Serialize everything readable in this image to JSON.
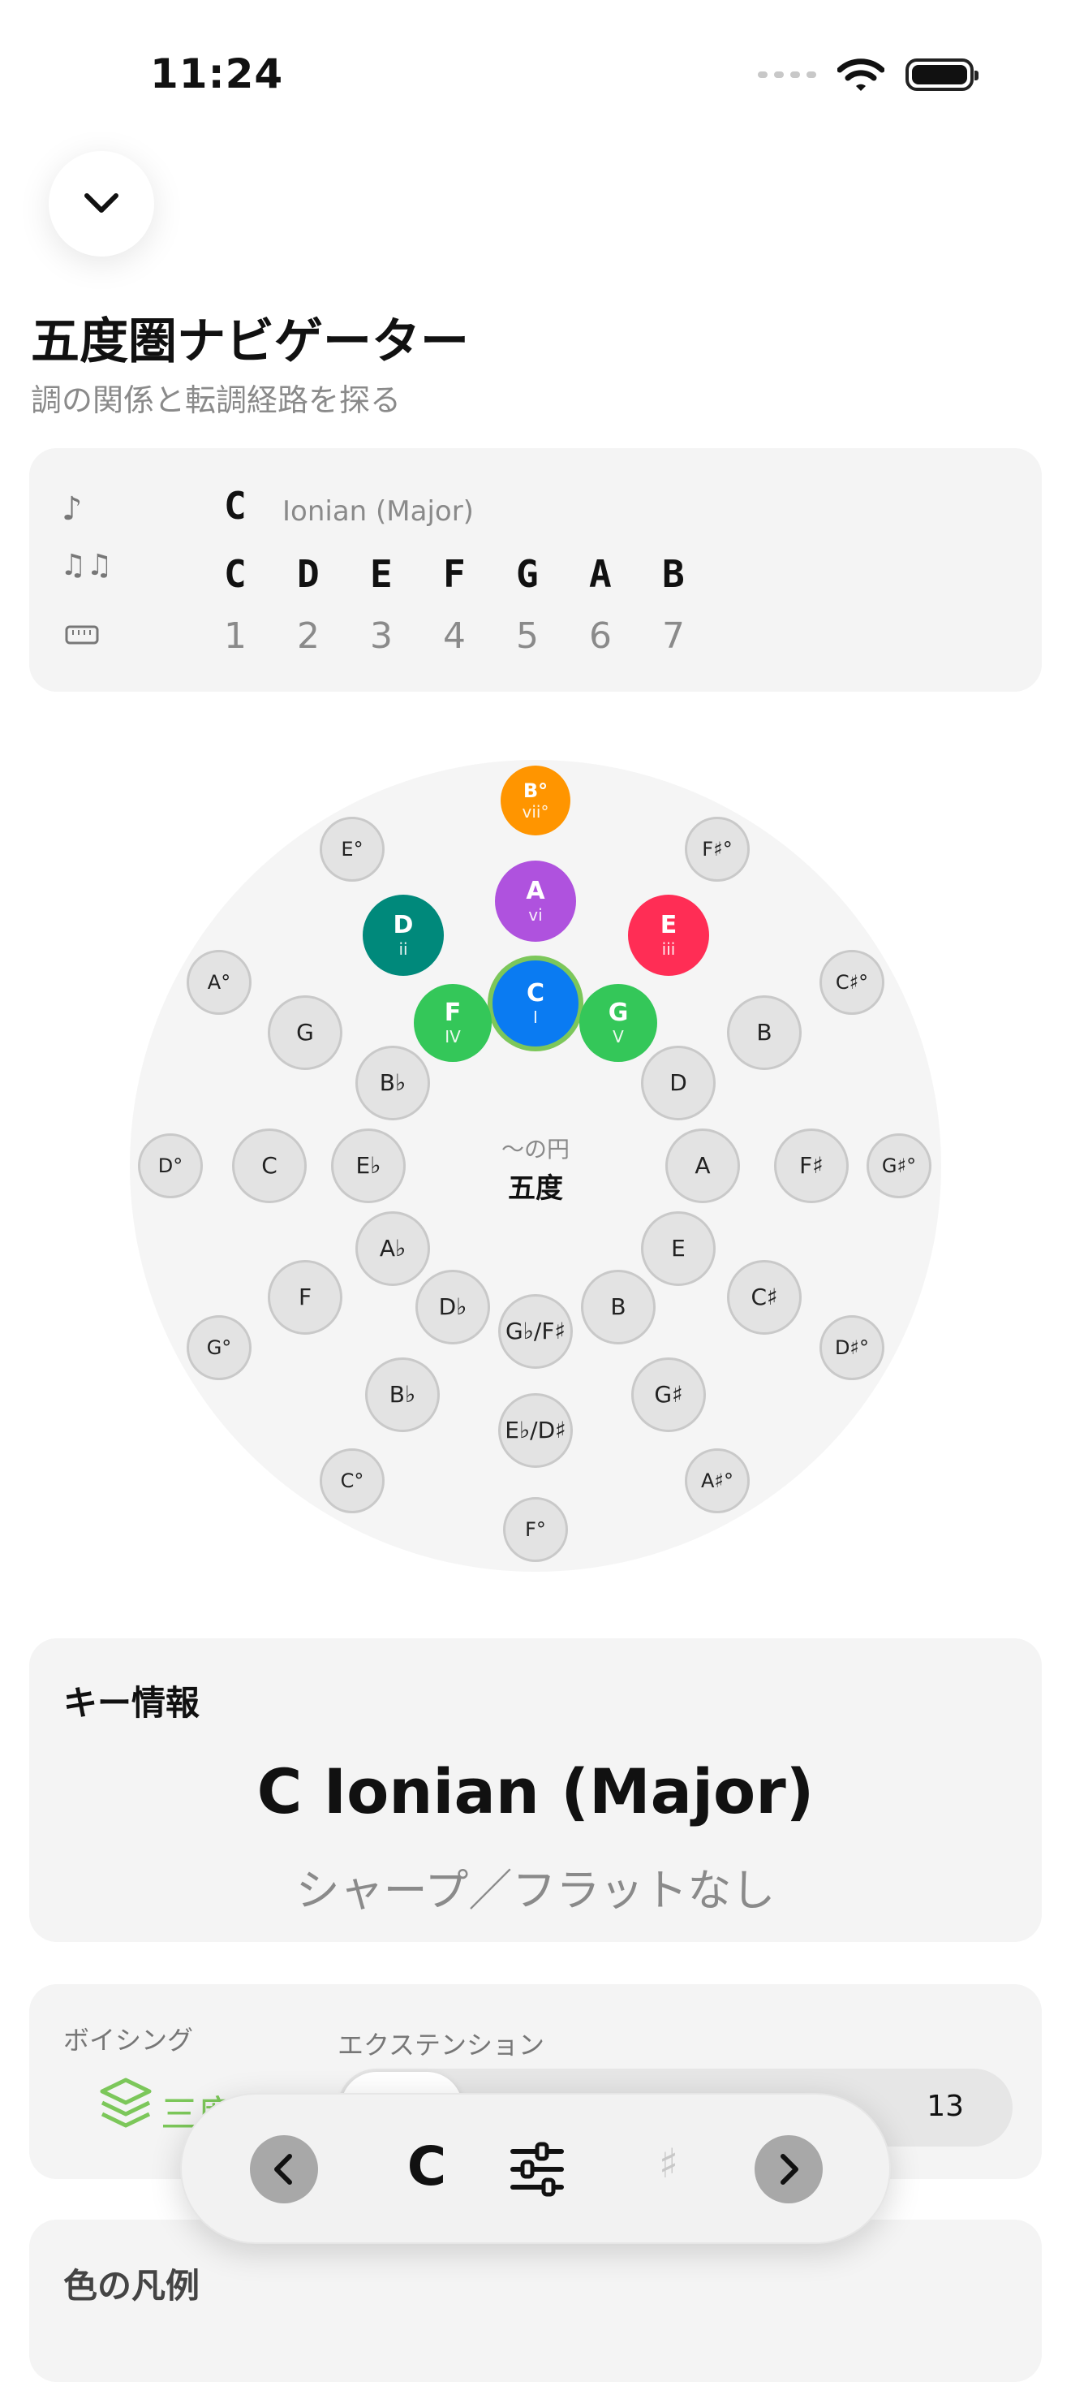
{
  "status": {
    "time": "11:24"
  },
  "header": {
    "title": "五度圏ナビゲーター",
    "subtitle": "調の関係と転調経路を探る"
  },
  "scale": {
    "root": "C",
    "mode": "Ionian (Major)",
    "notes": [
      "C",
      "D",
      "E",
      "F",
      "G",
      "A",
      "B"
    ],
    "degrees": [
      "1",
      "2",
      "3",
      "4",
      "5",
      "6",
      "7"
    ]
  },
  "circle": {
    "center_sub": "〜の円",
    "center_main": "五度",
    "diatonic": [
      {
        "name": "C",
        "roman": "I",
        "color": "#0a7bf2"
      },
      {
        "name": "G",
        "roman": "V",
        "color": "#34c759"
      },
      {
        "name": "F",
        "roman": "IV",
        "color": "#34c759"
      },
      {
        "name": "A",
        "roman": "vi",
        "color": "#af52de"
      },
      {
        "name": "E",
        "roman": "iii",
        "color": "#ff2d55"
      },
      {
        "name": "D",
        "roman": "ii",
        "color": "#00897b"
      },
      {
        "name": "B°",
        "roman": "vii°",
        "color": "#ff9500"
      }
    ],
    "major_ring": [
      "G",
      "D",
      "A",
      "E",
      "B",
      "G♭/F♯",
      "D♭",
      "A♭",
      "E♭",
      "B♭"
    ],
    "minor_ring": [
      "B",
      "F♯",
      "C♯",
      "G♯",
      "E♭/D♯",
      "B♭",
      "F",
      "C"
    ],
    "dim_ring": [
      "F♯°",
      "C♯°",
      "G♯°",
      "D♯°",
      "A♯°",
      "F°",
      "C°",
      "G°",
      "D°",
      "A°",
      "E°"
    ]
  },
  "key_info": {
    "heading": "キー情報",
    "key_name": "C Ionian (Major)",
    "accidentals": "シャープ／フラットなし"
  },
  "voicing": {
    "voicing_label": "ボイシング",
    "voicing_value": "三度",
    "extension_label": "エクステンション",
    "extension_value": "13"
  },
  "legend": {
    "heading": "色の凡例"
  },
  "toolbar": {
    "key": "C",
    "sharp": "♯"
  }
}
